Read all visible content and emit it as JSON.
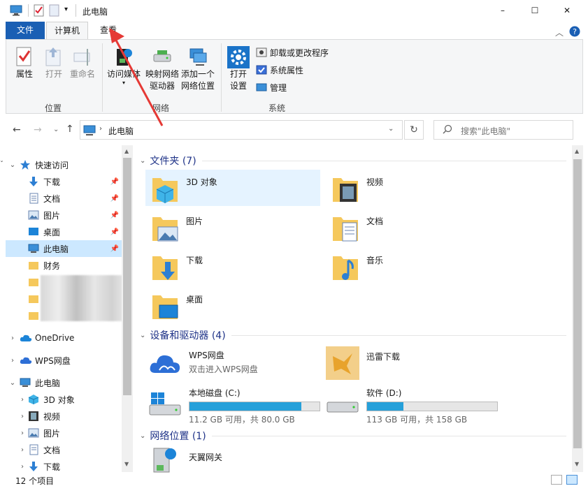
{
  "window": {
    "title": "此电脑",
    "minimize": "–",
    "maximize": "☐",
    "close": "✕"
  },
  "tabs": {
    "file": "文件",
    "computer": "计算机",
    "view": "查看"
  },
  "ribbon": {
    "location": {
      "label": "位置",
      "properties": "属性",
      "open": "打开",
      "rename": "重命名"
    },
    "network": {
      "label": "网络",
      "access_media": "访问媒体",
      "map_drive_1": "映射网络",
      "map_drive_2": "驱动器",
      "add_loc_1": "添加一个",
      "add_loc_2": "网络位置"
    },
    "system": {
      "label": "系统",
      "open_settings_1": "打开",
      "open_settings_2": "设置",
      "uninstall": "卸载或更改程序",
      "sys_props": "系统属性",
      "manage": "管理"
    }
  },
  "address": {
    "path": "此电脑",
    "search_placeholder": "搜索\"此电脑\""
  },
  "nav": {
    "quick_access": "快速访问",
    "items": [
      "下载",
      "文档",
      "图片",
      "桌面",
      "此电脑",
      "财务"
    ],
    "onedrive": "OneDrive",
    "wps": "WPS网盘",
    "this_pc": "此电脑",
    "pc_items": [
      "3D 对象",
      "视频",
      "图片",
      "文档",
      "下载"
    ]
  },
  "folders": {
    "header": "文件夹 (7)",
    "items": [
      "3D 对象",
      "视频",
      "图片",
      "文档",
      "下载",
      "音乐",
      "桌面"
    ]
  },
  "devices": {
    "header": "设备和驱动器 (4)",
    "wps_name": "WPS网盘",
    "wps_sub": "双击进入WPS网盘",
    "xunlei": "迅雷下载",
    "c_name": "本地磁盘 (C:)",
    "c_free": "11.2 GB 可用，共 80.0 GB",
    "c_used": 0.86,
    "d_name": "软件 (D:)",
    "d_free": "113 GB 可用，共 158 GB",
    "d_used": 0.28
  },
  "network": {
    "header": "网络位置 (1)",
    "item": "天翼网关"
  },
  "status": {
    "count": "12 个项目"
  },
  "colors": {
    "accent": "#1a5fb4",
    "selection": "#cce8ff",
    "drive_fill": "#26a0da",
    "folder": "#f5c85c",
    "arrow": "#e53935"
  }
}
